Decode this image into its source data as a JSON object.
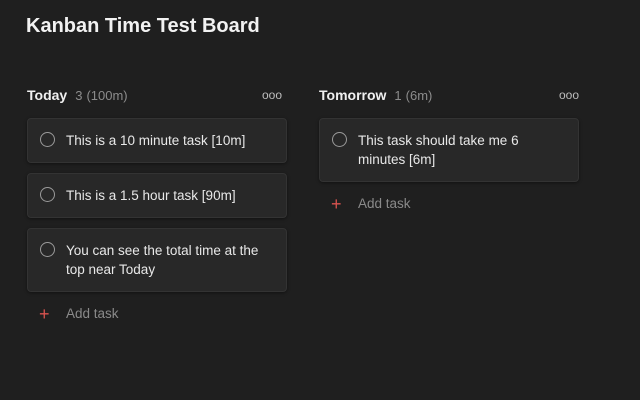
{
  "board": {
    "title": "Kanban Time Test Board"
  },
  "columns": [
    {
      "name": "Today",
      "count": "3",
      "time": "(100m)",
      "more_icon": "ooo",
      "tasks": [
        {
          "text": "This is a 10 minute task [10m]"
        },
        {
          "text": "This is a 1.5 hour task [90m]"
        },
        {
          "text": "You can see the total time at the top near Today"
        }
      ],
      "add_label": "Add task",
      "add_icon": "+"
    },
    {
      "name": "Tomorrow",
      "count": "1",
      "time": "(6m)",
      "more_icon": "ooo",
      "tasks": [
        {
          "text": "This task should take me 6 minutes [6m]"
        }
      ],
      "add_label": "Add task",
      "add_icon": "+"
    }
  ],
  "colors": {
    "background": "#1f1f1f",
    "card": "#282828",
    "accent_plus": "#d9534f"
  }
}
